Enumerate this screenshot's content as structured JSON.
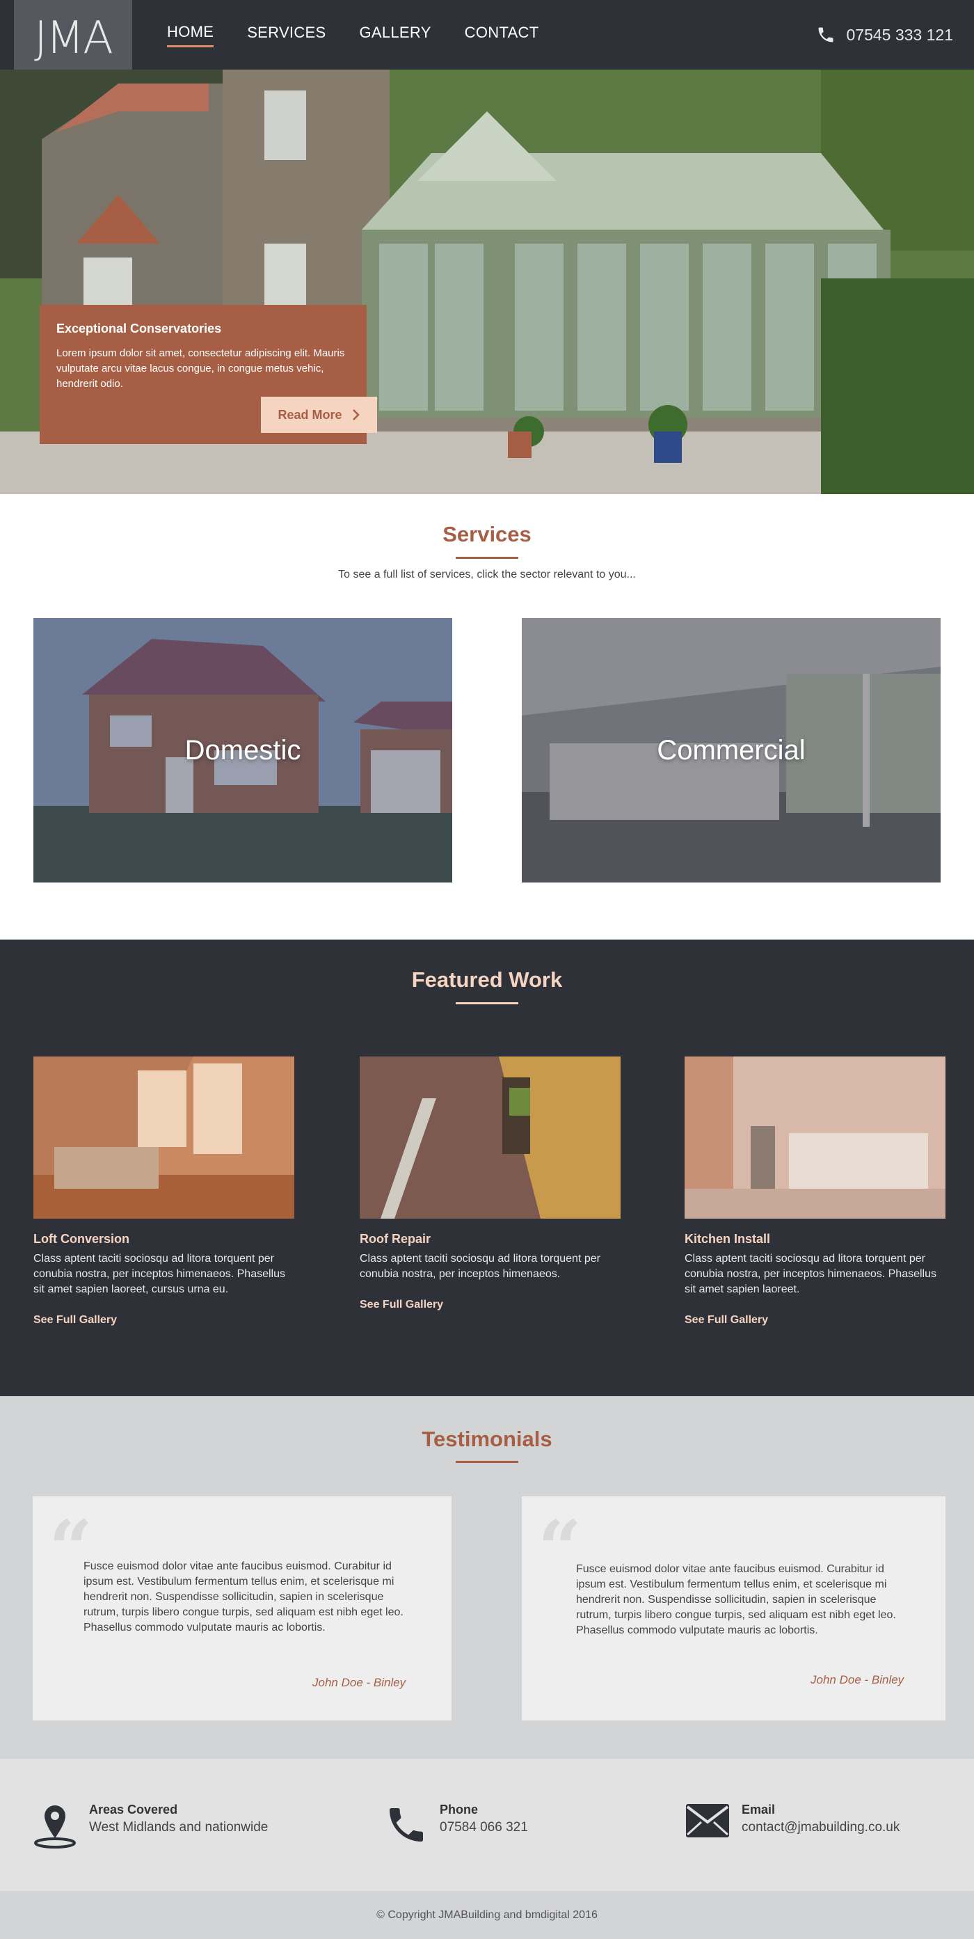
{
  "brand": {
    "logo_text": "JMA"
  },
  "nav": {
    "items": [
      {
        "label": "HOME",
        "active": true
      },
      {
        "label": "SERVICES",
        "active": false
      },
      {
        "label": "GALLERY",
        "active": false
      },
      {
        "label": "CONTACT",
        "active": false
      }
    ],
    "phone": "07545 333 121"
  },
  "hero": {
    "card_title": "Exceptional Conservatories",
    "card_text": "Lorem ipsum dolor sit amet, consectetur adipiscing elit. Mauris vulputate arcu vitae lacus congue, in congue metus vehic, hendrerit odio.",
    "button_label": "Read More"
  },
  "services": {
    "title": "Services",
    "subtitle": "To see a full list of services, click the sector relevant to you...",
    "tiles": [
      {
        "label": "Domestic"
      },
      {
        "label": "Commercial"
      }
    ]
  },
  "featured": {
    "title": "Featured Work",
    "items": [
      {
        "title": "Loft Conversion",
        "desc": "Class aptent taciti sociosqu ad litora torquent per conubia nostra, per inceptos himenaeos. Phasellus sit amet sapien laoreet, cursus urna eu.",
        "link": "See Full Gallery"
      },
      {
        "title": "Roof Repair",
        "desc": "Class aptent taciti sociosqu ad litora torquent per conubia nostra, per inceptos himenaeos.",
        "link": "See Full Gallery"
      },
      {
        "title": "Kitchen Install",
        "desc": "Class aptent taciti sociosqu ad litora torquent per conubia nostra, per inceptos himenaeos. Phasellus sit amet sapien laoreet.",
        "link": "See Full Gallery"
      }
    ]
  },
  "testimonials": {
    "title": "Testimonials",
    "items": [
      {
        "text": "Fusce euismod dolor vitae ante faucibus euismod. Curabitur id ipsum est. Vestibulum fermentum tellus enim, et scelerisque mi hendrerit non. Suspendisse sollicitudin, sapien in scelerisque rutrum, turpis libero congue turpis, sed aliquam est nibh eget leo. Phasellus commodo vulputate mauris ac lobortis.",
        "author": "John Doe - Binley"
      },
      {
        "text": "Fusce euismod dolor vitae ante faucibus euismod. Curabitur id ipsum est. Vestibulum fermentum tellus enim, et scelerisque mi hendrerit non. Suspendisse sollicitudin, sapien in scelerisque rutrum, turpis libero congue turpis, sed aliquam est nibh eget leo. Phasellus commodo vulputate mauris ac lobortis.",
        "author": "John Doe - Binley"
      }
    ]
  },
  "contact": {
    "areas_label": "Areas Covered",
    "areas_value": "West Midlands and nationwide",
    "phone_label": "Phone",
    "phone_value": "07584 066 321",
    "email_label": "Email",
    "email_value": "contact@jmabuilding.co.uk"
  },
  "footer": {
    "copyright": "© Copyright JMABuilding and bmdigital 2016"
  },
  "colors": {
    "accent": "#a65f44",
    "dark": "#2e3138",
    "peach": "#f6d4c2"
  },
  "icons": [
    "phone-icon",
    "chevron-right-icon",
    "location-pin-icon",
    "email-icon",
    "quote-icon"
  ]
}
